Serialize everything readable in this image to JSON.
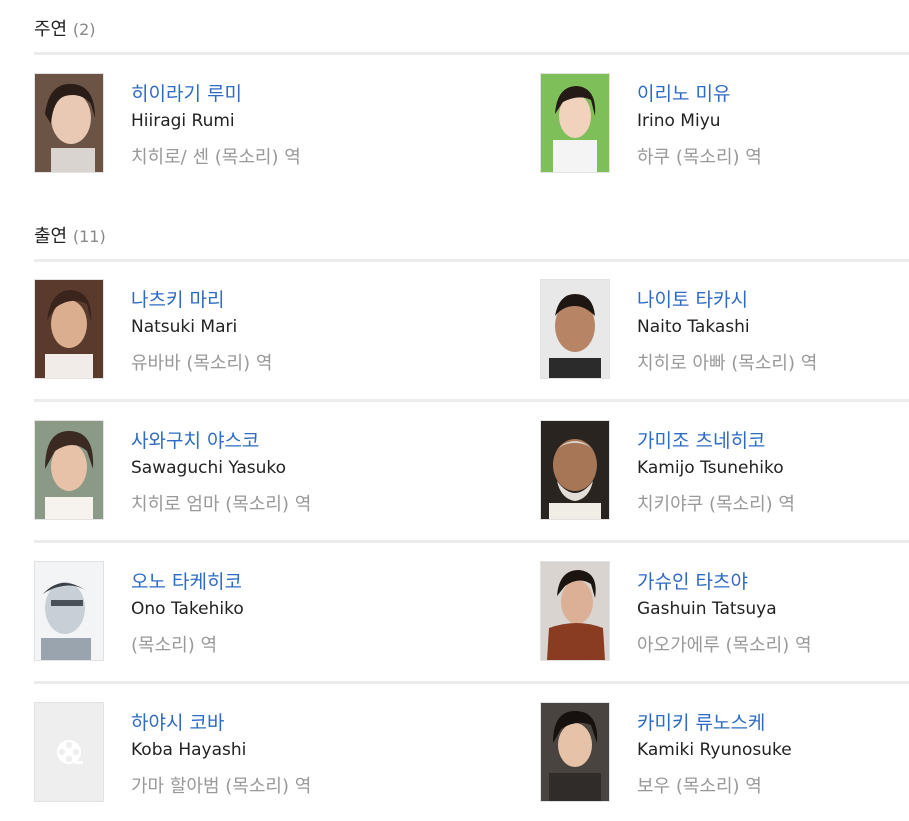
{
  "lead": {
    "title": "주연",
    "count": "(2)",
    "people": [
      {
        "name_ko": "히이라기 루미",
        "name_en": "Hiiragi Rumi",
        "role": "치히로/ 센 (목소리) 역",
        "photo": "portrait"
      },
      {
        "name_ko": "이리노 미유",
        "name_en": "Irino Miyu",
        "role": "하쿠 (목소리) 역",
        "photo": "portrait"
      }
    ]
  },
  "cast": {
    "title": "출연",
    "count": "(11)",
    "rows": [
      [
        {
          "name_ko": "나츠키 마리",
          "name_en": "Natsuki Mari",
          "role": "유바바 (목소리) 역",
          "photo": "portrait"
        },
        {
          "name_ko": "나이토 타카시",
          "name_en": "Naito Takashi",
          "role": "치히로 아빠 (목소리) 역",
          "photo": "portrait"
        }
      ],
      [
        {
          "name_ko": "사와구치 야스코",
          "name_en": "Sawaguchi Yasuko",
          "role": "치히로 엄마 (목소리) 역",
          "photo": "portrait"
        },
        {
          "name_ko": "가미조 츠네히코",
          "name_en": "Kamijo Tsunehiko",
          "role": "치키야쿠 (목소리) 역",
          "photo": "portrait"
        }
      ],
      [
        {
          "name_ko": "오노 타케히코",
          "name_en": "Ono Takehiko",
          "role": "(목소리) 역",
          "photo": "portrait"
        },
        {
          "name_ko": "가슈인 타츠야",
          "name_en": "Gashuin Tatsuya",
          "role": "아오가에루 (목소리) 역",
          "photo": "portrait"
        }
      ],
      [
        {
          "name_ko": "하야시 코바",
          "name_en": "Koba Hayashi",
          "role": "가마 할아범 (목소리) 역",
          "photo": "film-reel-placeholder-icon"
        },
        {
          "name_ko": "카미키 류노스케",
          "name_en": "Kamiki Ryunosuke",
          "role": "보우 (목소리) 역",
          "photo": "portrait"
        }
      ]
    ]
  },
  "colors": {
    "link": "#2d6bc4",
    "role": "#999999",
    "divider": "#ececec"
  }
}
